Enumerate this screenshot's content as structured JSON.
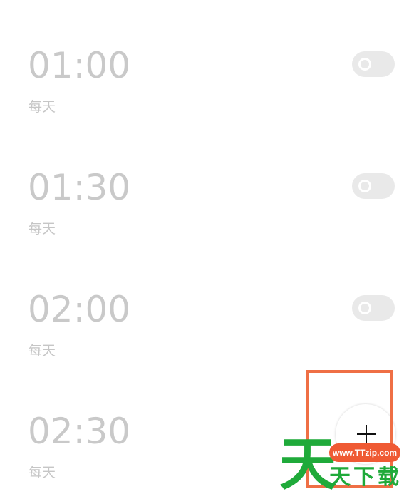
{
  "alarms": [
    {
      "time": "01:00",
      "repeat": "每天",
      "enabled": false
    },
    {
      "time": "01:30",
      "repeat": "每天",
      "enabled": false
    },
    {
      "time": "02:00",
      "repeat": "每天",
      "enabled": false
    },
    {
      "time": "02:30",
      "repeat": "每天",
      "enabled": false
    }
  ],
  "fab": {
    "icon": "plus-icon"
  },
  "watermark": {
    "url": "www.TTzip.com",
    "big_char": "天",
    "small_text": "天下载"
  },
  "colors": {
    "time_text": "#c9c9c9",
    "toggle_off": "#e9e9e9",
    "highlight": "#ef6f45",
    "watermark_green": "#1faa3a",
    "watermark_pill": "#ef5a34"
  }
}
